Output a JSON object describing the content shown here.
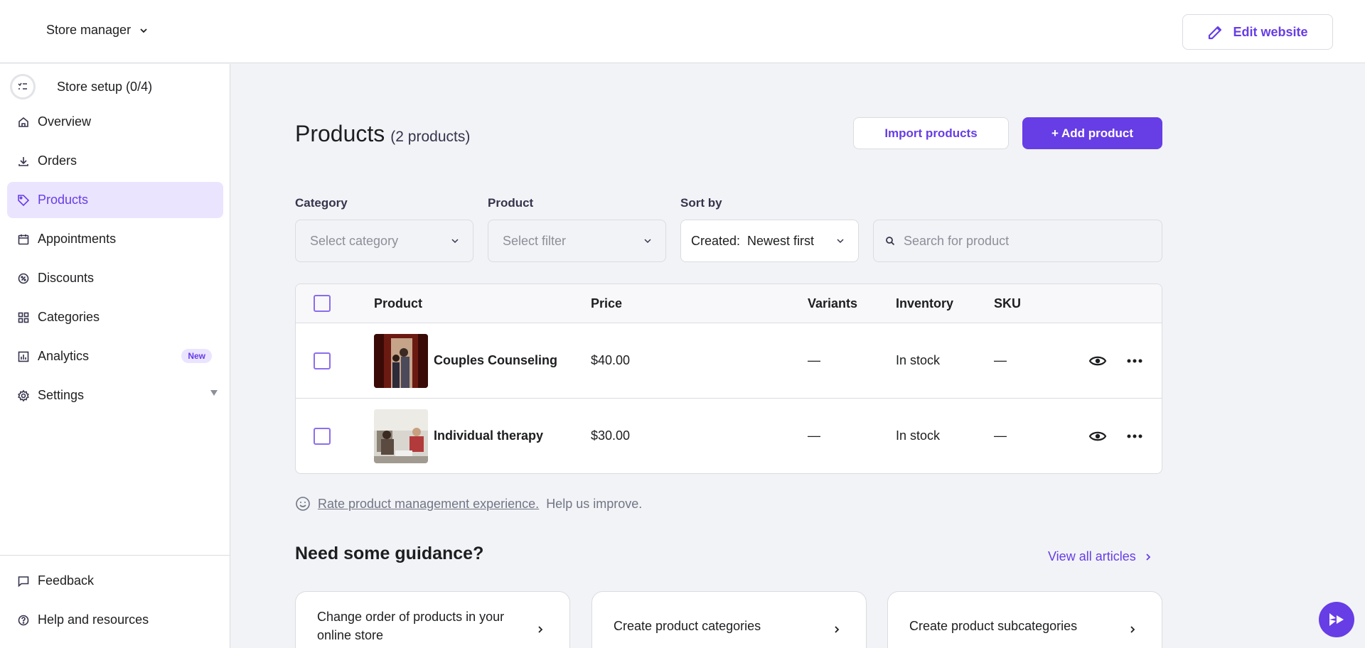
{
  "topbar": {
    "store_label": "Store manager",
    "edit_website_label": "Edit website"
  },
  "sidebar": {
    "setup_label": "Store setup (0/4)",
    "items": [
      {
        "label": "Overview",
        "icon": "home-icon"
      },
      {
        "label": "Orders",
        "icon": "download-icon"
      },
      {
        "label": "Products",
        "icon": "tag-icon",
        "active": true
      },
      {
        "label": "Appointments",
        "icon": "calendar-icon"
      },
      {
        "label": "Discounts",
        "icon": "discount-icon"
      },
      {
        "label": "Categories",
        "icon": "grid-icon"
      },
      {
        "label": "Analytics",
        "icon": "chart-icon",
        "badge": "New"
      },
      {
        "label": "Settings",
        "icon": "gear-icon"
      }
    ],
    "bottom": [
      {
        "label": "Feedback",
        "icon": "message-icon"
      },
      {
        "label": "Help and resources",
        "icon": "help-icon"
      }
    ]
  },
  "main": {
    "title": "Products",
    "count": "(2 products)",
    "import_label": "Import products",
    "add_label": "+ Add product",
    "filters": {
      "category_label": "Category",
      "category_placeholder": "Select category",
      "product_label": "Product",
      "product_placeholder": "Select filter",
      "sort_label": "Sort by",
      "sort_value": "Created:  Newest first",
      "search_placeholder": "Search for product"
    },
    "table": {
      "headers": [
        "Product",
        "Price",
        "Variants",
        "Inventory",
        "SKU"
      ],
      "rows": [
        {
          "name": "Couples Counseling",
          "price": "$40.00",
          "variants": "—",
          "inventory": "In stock",
          "sku": "—"
        },
        {
          "name": "Individual therapy",
          "price": "$30.00",
          "variants": "—",
          "inventory": "In stock",
          "sku": "—"
        }
      ]
    },
    "rate": {
      "link": "Rate product management experience.",
      "text": "Help us improve."
    },
    "guidance": {
      "title": "Need some guidance?",
      "view_all": "View all articles",
      "cards": [
        "Change order of products in your online store",
        "Create product categories",
        "Create product subcategories"
      ]
    }
  },
  "colors": {
    "accent": "#673de6",
    "accent_light": "#ebe4ff",
    "background": "#f2f3f6"
  }
}
